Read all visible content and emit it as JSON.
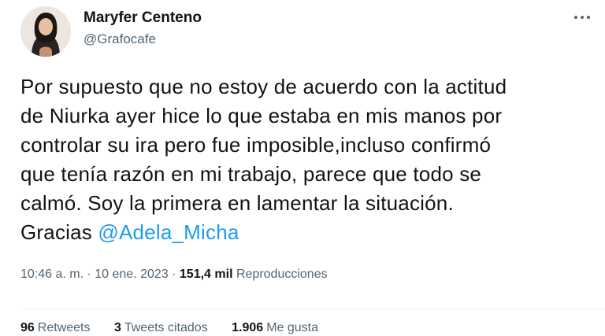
{
  "author": {
    "name": "Maryfer Centeno",
    "handle": "@Grafocafe"
  },
  "tweet": {
    "lines": [
      "Por supuesto que no estoy de acuerdo con la actitud",
      "de Niurka ayer hice lo que estaba en mis manos por",
      "controlar su ira pero fue imposible,incluso confirmó",
      "que tenía razón en mi trabajo, parece que todo se",
      "calmó. Soy la primera en lamentar la situación."
    ],
    "last_line_prefix": "Gracias ",
    "mention": "@Adela_Micha"
  },
  "meta": {
    "time": "10:46 a. m.",
    "sep1": " · ",
    "date": "10 ene. 2023",
    "sep2": " · ",
    "views_count": "151,4 mil",
    "views_label": "Reproducciones"
  },
  "stats": {
    "retweets_count": "96",
    "retweets_label": "Retweets",
    "quotes_count": "3",
    "quotes_label": "Tweets citados",
    "likes_count": "1.906",
    "likes_label": "Me gusta"
  },
  "icons": {
    "more": "more-horizontal-icon"
  },
  "colors": {
    "accent": "#1d9bf0",
    "text": "#0f1419",
    "secondary": "#536471"
  }
}
